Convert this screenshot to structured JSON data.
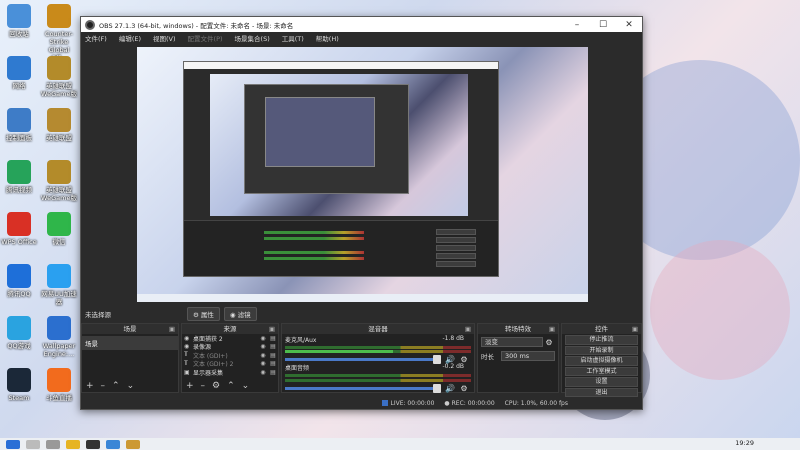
{
  "desktop": {
    "icons_left": [
      {
        "label": "回收站",
        "color": "#4a90d9"
      },
      {
        "label": "网络",
        "color": "#2f7ad0"
      },
      {
        "label": "控制面板",
        "color": "#3e7cc7"
      },
      {
        "label": "腾讯视频",
        "color": "#26a35a"
      },
      {
        "label": "WPS Office",
        "color": "#d93025"
      },
      {
        "label": "腾讯QQ",
        "color": "#1e6fd9"
      },
      {
        "label": "QQ游戏",
        "color": "#2aa3e0"
      },
      {
        "label": "Steam",
        "color": "#1b2838"
      }
    ],
    "icons_right": [
      {
        "label": "Counter-Strike Global Off...",
        "color": "#c98a1a"
      },
      {
        "label": "英雄联盟WeGame版",
        "color": "#b38b2a"
      },
      {
        "label": "英雄联盟",
        "color": "#b58a30"
      },
      {
        "label": "英雄联盟WeGame版",
        "color": "#b38b2a"
      },
      {
        "label": "微信",
        "color": "#2fb64a"
      },
      {
        "label": "网易UU加速器",
        "color": "#2aa0f0"
      },
      {
        "label": "Wallpaper Engine:...",
        "color": "#2b6fcf"
      },
      {
        "label": "斗鱼直播",
        "color": "#f26b1d"
      }
    ]
  },
  "window": {
    "title": "OBS 27.1.3 (64-bit, windows) - 配置文件: 未命名 - 场景: 未命名",
    "menu": [
      "文件(F)",
      "编辑(E)",
      "视图(V)",
      "配置文件(P)",
      "场景集合(S)",
      "工具(T)",
      "帮助(H)"
    ],
    "menu_disabled": "配置文件(P)"
  },
  "source_bar": {
    "no_selection": "未选择源",
    "properties": "属性",
    "filters": "滤镜"
  },
  "docks": {
    "scenes": {
      "title": "场景",
      "items": [
        "场景"
      ]
    },
    "sources": {
      "title": "来源",
      "items": [
        {
          "name": "桌面捕获 2",
          "dim": false
        },
        {
          "name": "录像源",
          "dim": false
        },
        {
          "name": "文本 (GDI+)",
          "dim": true
        },
        {
          "name": "文本 (GDI+) 2",
          "dim": true
        },
        {
          "name": "显示器采集",
          "dim": false
        }
      ]
    },
    "mixer": {
      "title": "混音器",
      "channels": [
        {
          "name": "麦克风/Aux",
          "db": "-1.8 dB"
        },
        {
          "name": "桌面音频",
          "db": "-0.2 dB"
        }
      ]
    },
    "transitions": {
      "title": "转场特效",
      "type": "淡变",
      "duration_label": "时长",
      "duration": "300 ms"
    },
    "controls": {
      "title": "控件",
      "buttons": [
        "停止推流",
        "开始录制",
        "启动虚拟摄像机",
        "工作室模式",
        "设置",
        "退出"
      ]
    }
  },
  "status": {
    "live": "LIVE: 00:00:00",
    "rec": "REC: 00:00:00",
    "cpu": "CPU: 1.0%, 60.00 fps"
  },
  "taskbar": {
    "time": "19:29"
  }
}
